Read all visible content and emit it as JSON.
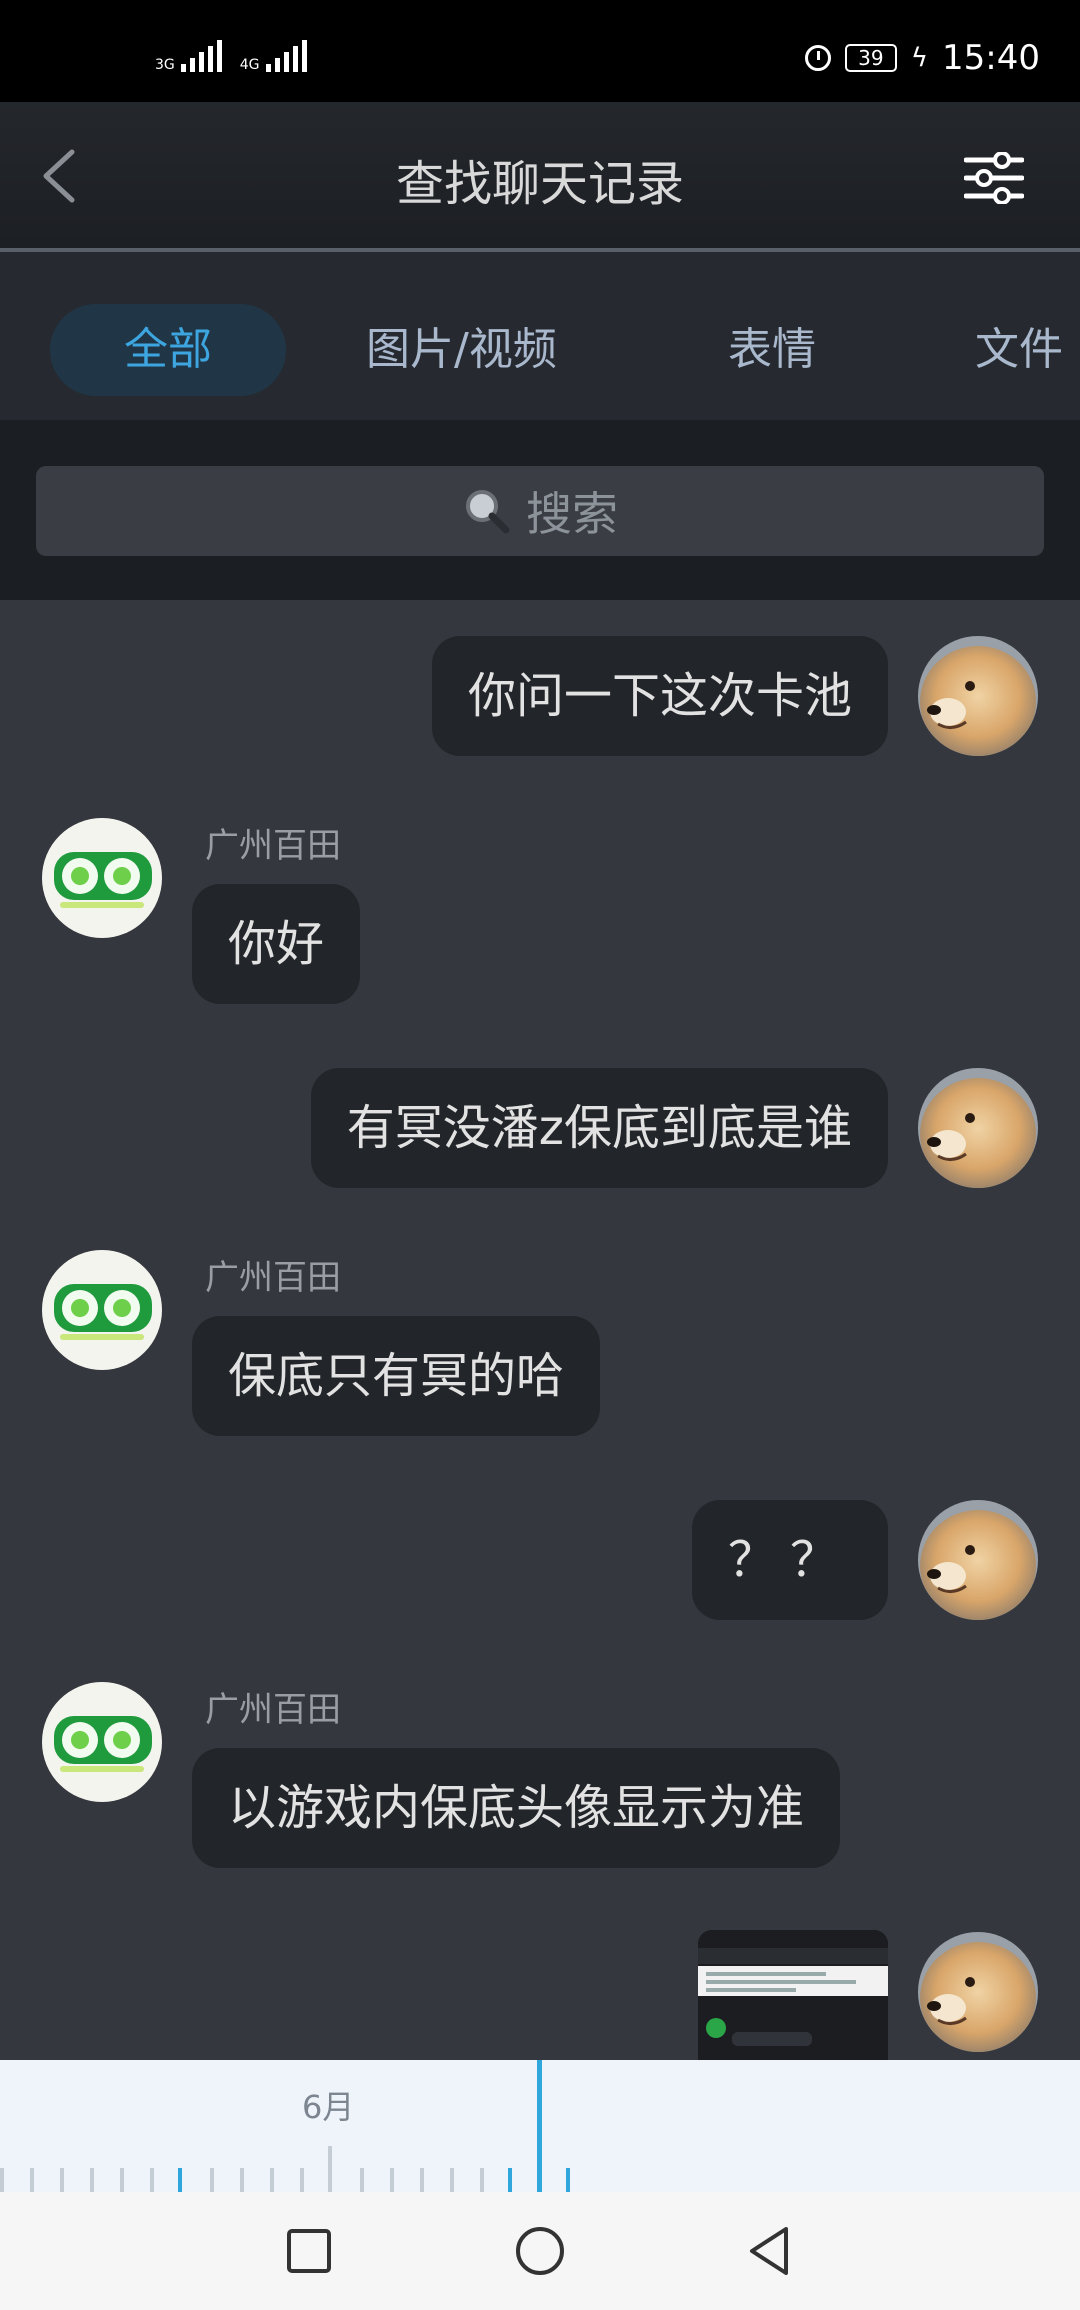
{
  "status_bar": {
    "network1": "3G",
    "network2": "4G",
    "battery": "39",
    "time": "15:40"
  },
  "header": {
    "title": "查找聊天记录"
  },
  "tabs": [
    {
      "label": "全部",
      "active": true
    },
    {
      "label": "图片/视频",
      "active": false
    },
    {
      "label": "表情",
      "active": false
    },
    {
      "label": "文件",
      "active": false
    }
  ],
  "search": {
    "placeholder": "搜索"
  },
  "messages": [
    {
      "side": "right",
      "text": "你问一下这次卡池"
    },
    {
      "side": "left",
      "sender": "广州百田",
      "text": "你好"
    },
    {
      "side": "right",
      "text": "有冥没潘z保底到底是谁"
    },
    {
      "side": "left",
      "sender": "广州百田",
      "text": "保底只有冥的哈"
    },
    {
      "side": "right",
      "text": "？？"
    },
    {
      "side": "left",
      "sender": "广州百田",
      "text": "以游戏内保底头像显示为准"
    },
    {
      "side": "right",
      "type": "image"
    }
  ],
  "timeline": {
    "month_label": "6月"
  },
  "colors": {
    "accent": "#3da6e0",
    "bubble": "#222529",
    "chat_bg": "#34383e"
  }
}
